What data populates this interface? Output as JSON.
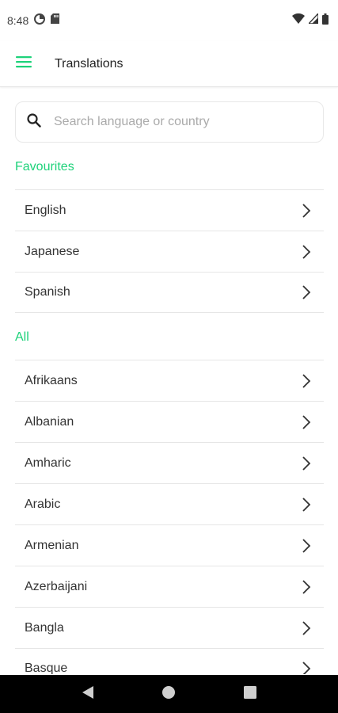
{
  "status_bar": {
    "time": "8:48",
    "icons": [
      "data-saver-icon",
      "sd-card-icon",
      "wifi-icon",
      "signal-icon",
      "battery-icon"
    ]
  },
  "app_bar": {
    "title": "Translations",
    "menu_icon": "hamburger-menu-icon"
  },
  "search": {
    "placeholder": "Search language or country",
    "value": ""
  },
  "sections": {
    "favourites": {
      "title": "Favourites",
      "items": [
        "English",
        "Japanese",
        "Spanish"
      ]
    },
    "all": {
      "title": "All",
      "items": [
        "Afrikaans",
        "Albanian",
        "Amharic",
        "Arabic",
        "Armenian",
        "Azerbaijani",
        "Bangla",
        "Basque"
      ]
    }
  },
  "colors": {
    "accent": "#1ed27a",
    "text": "#333333",
    "divider": "#e6e6e6",
    "nav_bar": "#000000"
  },
  "nav_bar": {
    "buttons": [
      "back-icon",
      "home-icon",
      "recents-icon"
    ]
  }
}
